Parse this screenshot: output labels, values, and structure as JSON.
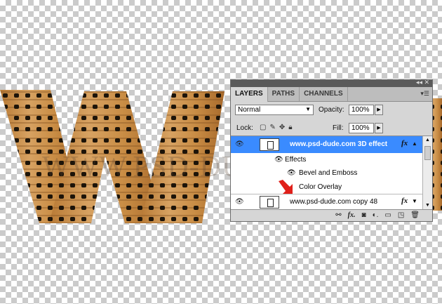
{
  "watermark": "WWW.PSD-DUDE.COM",
  "panel": {
    "tabs": [
      "LAYERS",
      "PATHS",
      "CHANNELS"
    ],
    "blend_mode": "Normal",
    "opacity_label": "Opacity:",
    "opacity_value": "100%",
    "lock_label": "Lock:",
    "fill_label": "Fill:",
    "fill_value": "100%",
    "layers": [
      {
        "name": "www.psd-dude.com 3D effect",
        "selected": true,
        "fx": "fx"
      },
      {
        "name": "Effects"
      },
      {
        "name": "Bevel and Emboss"
      },
      {
        "name": "Color Overlay"
      },
      {
        "name": "www.psd-dude.com copy 48",
        "fx": "fx"
      }
    ],
    "colors": {
      "selected": "#3a8bff",
      "panel": "#d6d6d6",
      "arrow": "#e0201a"
    }
  }
}
